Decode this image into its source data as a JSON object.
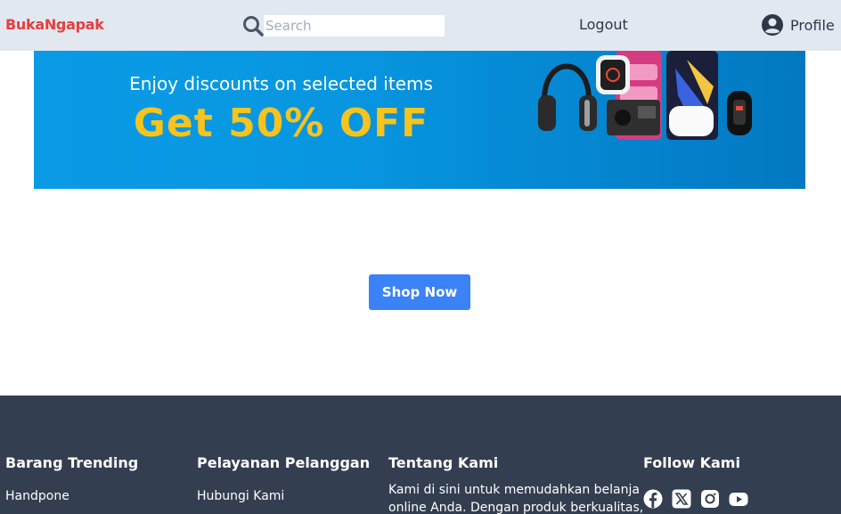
{
  "header": {
    "brand": "BukaNgapak",
    "search_placeholder": "Search",
    "logout_label": "Logout",
    "profile_label": "Profile"
  },
  "banner": {
    "subtitle": "Enjoy discounts on selected items",
    "headline": "Get 50% OFF"
  },
  "main": {
    "shop_now_label": "Shop Now"
  },
  "footer": {
    "trending": {
      "heading": "Barang Trending",
      "items": [
        "Handpone"
      ]
    },
    "service": {
      "heading": "Pelayanan Pelanggan",
      "items": [
        "Hubungi Kami"
      ]
    },
    "about": {
      "heading": "Tentang Kami",
      "text_line1": "Kami di sini untuk memudahkan belanja",
      "text_line2": "online Anda. Dengan produk berkualitas,"
    },
    "follow": {
      "heading": "Follow Kami",
      "icons": [
        "facebook-icon",
        "x-icon",
        "instagram-icon",
        "youtube-icon"
      ]
    }
  },
  "colors": {
    "brand": "#e53e3e",
    "header_bg": "#e2e8f0",
    "banner_accent": "#f7c31e",
    "button": "#3b82f6",
    "footer_bg": "#333e50"
  }
}
